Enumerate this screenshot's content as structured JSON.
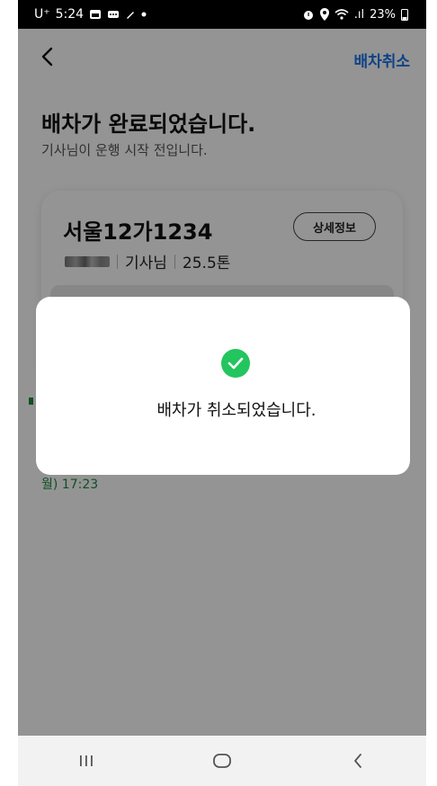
{
  "status_bar": {
    "carrier": "U⁺",
    "time": "5:24",
    "signal": ".ıl",
    "battery": "23%"
  },
  "header": {
    "back_icon": "chevron-left-icon",
    "action_label": "배차취소"
  },
  "main": {
    "title": "배차가 완료되었습니다.",
    "subtitle": "기사님이 운행 시작 전입니다."
  },
  "vehicle_card": {
    "plate_number": "서울12가1234",
    "detail_button_label": "상세정보",
    "driver_suffix": "기사님",
    "tonnage": "25.5톤"
  },
  "schedule": {
    "datetime_fragment": "월) 17:23"
  },
  "dialog": {
    "icon": "check-circle-icon",
    "message": "배차가 취소되었습니다."
  },
  "nav": {
    "recents_icon": "recent-apps-icon",
    "home_icon": "home-icon",
    "back_icon": "back-icon"
  },
  "colors": {
    "accent": "#1a73e8",
    "success": "#22c55e",
    "date_green": "#1e8a3c",
    "overlay": "rgba(0,0,0,0.42)"
  }
}
